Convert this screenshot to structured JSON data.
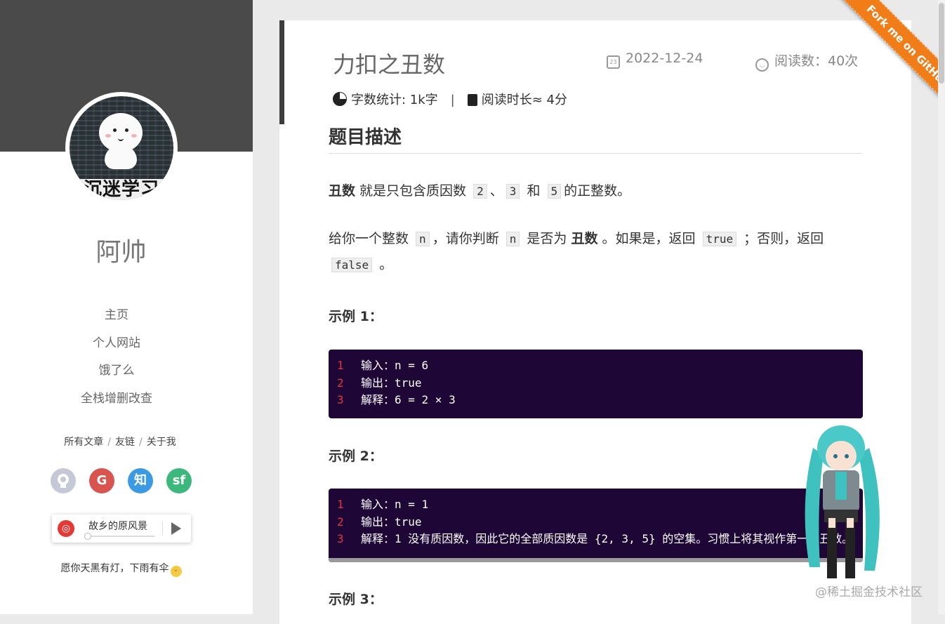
{
  "sidebar": {
    "avatar_caption": "沉迷学习",
    "site_title": "阿帅",
    "menu": [
      "主页",
      "个人网站",
      "饿了么",
      "全栈增删改查"
    ],
    "links": [
      "所有文章",
      "友链",
      "关于我"
    ],
    "link_separator": "/",
    "socials": [
      {
        "name": "github-icon",
        "glyph": "",
        "color": "#c5c8d6"
      },
      {
        "name": "gitee-icon",
        "glyph": "G",
        "color": "#d9534f"
      },
      {
        "name": "zhihu-icon",
        "glyph": "知",
        "color": "#3b9ae1"
      },
      {
        "name": "segmentfault-icon",
        "glyph": "sf",
        "color": "#3cb87c"
      }
    ],
    "player": {
      "song": "故乡的原风景"
    },
    "motto": "愿你天黑有灯，下雨有伞"
  },
  "post": {
    "title": "力扣之丑数",
    "date": "2022-12-24",
    "views": "阅读数：40次",
    "word_count": "字数统计: 1k字",
    "stat_separator": "|",
    "read_time": "阅读时长≈ 4分",
    "section_heading": "题目描述",
    "para1": {
      "bold": "丑数",
      "t1": " 就是只包含质因数 ",
      "c1": "2",
      "t2": "、",
      "c2": "3",
      "t3": " 和 ",
      "c3": "5",
      "t4": "的正整数。"
    },
    "para2": {
      "t1": "给你一个整数 ",
      "c1": "n",
      "t2": "，请你判断 ",
      "c2": "n",
      "t3": " 是否为 ",
      "bold": "丑数",
      "t4": " 。如果是，返回 ",
      "c3": "true",
      "t5": " ；否则，返回 ",
      "c4": "false",
      "t6": " 。"
    },
    "example1_label": "示例 1：",
    "example2_label": "示例 2：",
    "example3_label": "示例 3：",
    "example1": [
      "输入：n = 6",
      "输出：true",
      "解释：6 = 2 × 3"
    ],
    "example2": [
      "输入：n = 1",
      "输出：true",
      "解释：1 没有质因数，因此它的全部质因数是 {2, 3, 5} 的空集。习惯上将其视作第一个丑数。"
    ]
  },
  "ribbon": "Fork me on GitHub",
  "watermark": "@稀土掘金技术社区",
  "colors": {
    "accent": "#f07d18",
    "code_bg": "#1e0637",
    "line_number": "#e3373d"
  }
}
